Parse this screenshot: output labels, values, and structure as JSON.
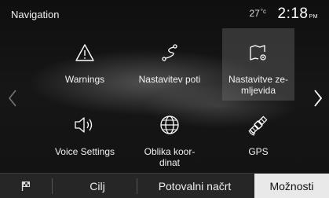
{
  "header": {
    "title": "Navigation",
    "temperature": "27",
    "temperature_unit": "°c",
    "time": "2:18",
    "time_suffix": "PM"
  },
  "menu": [
    {
      "label": "Warnings",
      "icon": "warning-triangle-icon"
    },
    {
      "label": "Nastavitev poti",
      "icon": "route-icon"
    },
    {
      "label": "Nastavitve ze-\nmljevida",
      "icon": "map-settings-icon",
      "selected": true
    },
    {
      "label": "Voice Settings",
      "icon": "speaker-icon"
    },
    {
      "label": "Oblika koor-\ndinat",
      "icon": "globe-icon"
    },
    {
      "label": "GPS",
      "icon": "satellite-icon"
    }
  ],
  "bottom_bar": {
    "flag_icon": "checkered-flag-icon",
    "destination": "Cilj",
    "route_plan": "Potovalni načrt",
    "options": "Možnosti"
  }
}
